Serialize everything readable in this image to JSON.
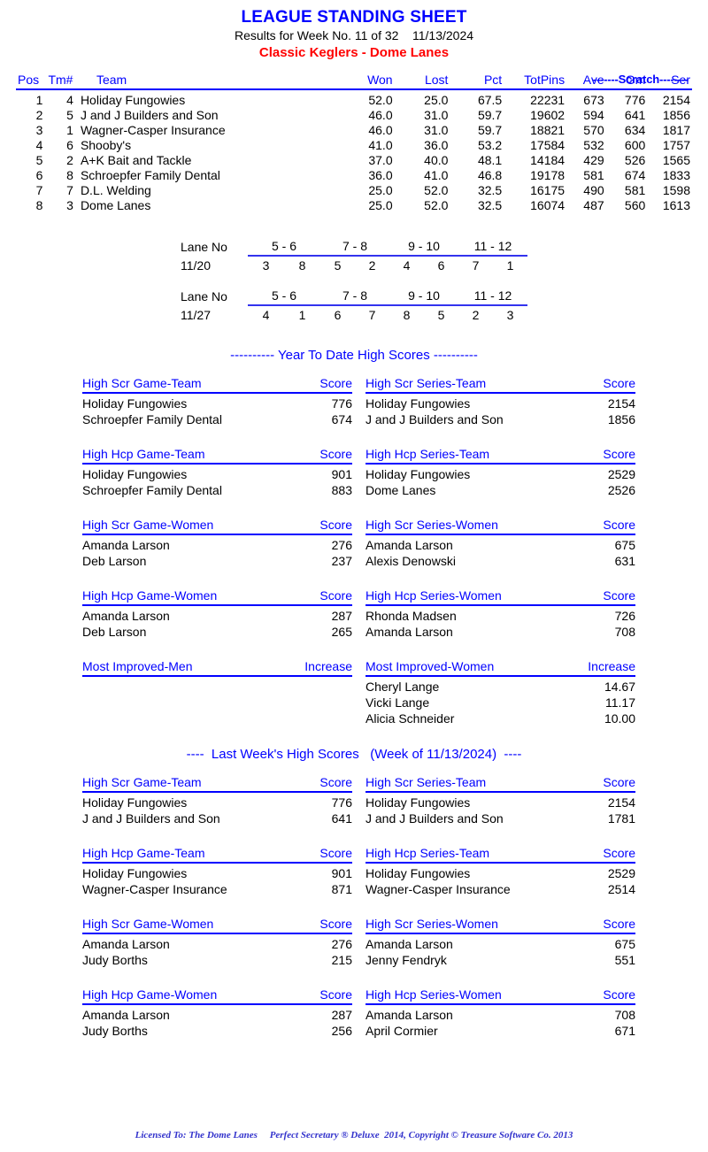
{
  "header": {
    "title": "LEAGUE STANDING SHEET",
    "subtitle": "Results for Week No. 11 of 32    11/13/2024",
    "league": "Classic Keglers - Dome Lanes"
  },
  "standings": {
    "scratch_label": "-------Scratch--------",
    "columns": {
      "pos": "Pos",
      "tm": "Tm#",
      "team": "Team",
      "won": "Won",
      "lost": "Lost",
      "pct": "Pct",
      "totpins": "TotPins",
      "ave": "Ave",
      "gm": "Gm",
      "ser": "Ser"
    },
    "rows": [
      {
        "pos": "1",
        "tm": "4",
        "team": "Holiday Fungowies",
        "won": "52.0",
        "lost": "25.0",
        "pct": "67.5",
        "totpins": "22231",
        "ave": "673",
        "gm": "776",
        "ser": "2154"
      },
      {
        "pos": "2",
        "tm": "5",
        "team": "J and J Builders and Son",
        "won": "46.0",
        "lost": "31.0",
        "pct": "59.7",
        "totpins": "19602",
        "ave": "594",
        "gm": "641",
        "ser": "1856"
      },
      {
        "pos": "3",
        "tm": "1",
        "team": "Wagner-Casper Insurance",
        "won": "46.0",
        "lost": "31.0",
        "pct": "59.7",
        "totpins": "18821",
        "ave": "570",
        "gm": "634",
        "ser": "1817"
      },
      {
        "pos": "4",
        "tm": "6",
        "team": "Shooby's",
        "won": "41.0",
        "lost": "36.0",
        "pct": "53.2",
        "totpins": "17584",
        "ave": "532",
        "gm": "600",
        "ser": "1757"
      },
      {
        "pos": "5",
        "tm": "2",
        "team": "A+K Bait and Tackle",
        "won": "37.0",
        "lost": "40.0",
        "pct": "48.1",
        "totpins": "14184",
        "ave": "429",
        "gm": "526",
        "ser": "1565"
      },
      {
        "pos": "6",
        "tm": "8",
        "team": "Schroepfer Family Dental",
        "won": "36.0",
        "lost": "41.0",
        "pct": "46.8",
        "totpins": "19178",
        "ave": "581",
        "gm": "674",
        "ser": "1833"
      },
      {
        "pos": "7",
        "tm": "7",
        "team": "D.L. Welding",
        "won": "25.0",
        "lost": "52.0",
        "pct": "32.5",
        "totpins": "16175",
        "ave": "490",
        "gm": "581",
        "ser": "1598"
      },
      {
        "pos": "8",
        "tm": "3",
        "team": "Dome Lanes",
        "won": "25.0",
        "lost": "52.0",
        "pct": "32.5",
        "totpins": "16074",
        "ave": "487",
        "gm": "560",
        "ser": "1613"
      }
    ]
  },
  "lane_schedule": [
    {
      "label": "Lane No",
      "date": "11/20",
      "lanes": [
        "5 - 6",
        "7 - 8",
        "9 - 10",
        "11 - 12"
      ],
      "matchups": [
        [
          "3",
          "8"
        ],
        [
          "5",
          "2"
        ],
        [
          "4",
          "6"
        ],
        [
          "7",
          "1"
        ]
      ]
    },
    {
      "label": "Lane No",
      "date": "11/27",
      "lanes": [
        "5 - 6",
        "7 - 8",
        "9 - 10",
        "11 - 12"
      ],
      "matchups": [
        [
          "4",
          "1"
        ],
        [
          "6",
          "7"
        ],
        [
          "8",
          "5"
        ],
        [
          "2",
          "3"
        ]
      ]
    }
  ],
  "ytd": {
    "heading": "---------- Year To Date High Scores ----------",
    "blocks": [
      {
        "left": {
          "title": "High Scr Game-Team",
          "score_label": "Score",
          "rows": [
            {
              "name": "Holiday Fungowies",
              "value": "776"
            },
            {
              "name": "Schroepfer Family Dental",
              "value": "674"
            }
          ]
        },
        "right": {
          "title": "High Scr Series-Team",
          "score_label": "Score",
          "rows": [
            {
              "name": "Holiday Fungowies",
              "value": "2154"
            },
            {
              "name": "J and J Builders and Son",
              "value": "1856"
            }
          ]
        }
      },
      {
        "left": {
          "title": "High Hcp Game-Team",
          "score_label": "Score",
          "rows": [
            {
              "name": "Holiday Fungowies",
              "value": "901"
            },
            {
              "name": "Schroepfer Family Dental",
              "value": "883"
            }
          ]
        },
        "right": {
          "title": "High Hcp Series-Team",
          "score_label": "Score",
          "rows": [
            {
              "name": "Holiday Fungowies",
              "value": "2529"
            },
            {
              "name": "Dome Lanes",
              "value": "2526"
            }
          ]
        }
      },
      {
        "left": {
          "title": "High Scr Game-Women",
          "score_label": "Score",
          "rows": [
            {
              "name": "Amanda Larson",
              "value": "276"
            },
            {
              "name": "Deb Larson",
              "value": "237"
            }
          ]
        },
        "right": {
          "title": "High Scr Series-Women",
          "score_label": "Score",
          "rows": [
            {
              "name": "Amanda Larson",
              "value": "675"
            },
            {
              "name": "Alexis Denowski",
              "value": "631"
            }
          ]
        }
      },
      {
        "left": {
          "title": "High Hcp Game-Women",
          "score_label": "Score",
          "rows": [
            {
              "name": "Amanda Larson",
              "value": "287"
            },
            {
              "name": "Deb Larson",
              "value": "265"
            }
          ]
        },
        "right": {
          "title": "High Hcp Series-Women",
          "score_label": "Score",
          "rows": [
            {
              "name": "Rhonda Madsen",
              "value": "726"
            },
            {
              "name": "Amanda Larson",
              "value": "708"
            }
          ]
        }
      },
      {
        "left": {
          "title": "Most Improved-Men",
          "score_label": "Increase",
          "rows": []
        },
        "right": {
          "title": "Most Improved-Women",
          "score_label": "Increase",
          "rows": [
            {
              "name": "Cheryl Lange",
              "value": "14.67"
            },
            {
              "name": "Vicki Lange",
              "value": "11.17"
            },
            {
              "name": "Alicia Schneider",
              "value": "10.00"
            }
          ]
        }
      }
    ]
  },
  "last_week": {
    "heading": "----  Last Week's High Scores   (Week of 11/13/2024)  ----",
    "blocks": [
      {
        "left": {
          "title": "High Scr Game-Team",
          "score_label": "Score",
          "rows": [
            {
              "name": "Holiday Fungowies",
              "value": "776"
            },
            {
              "name": "J and J Builders and Son",
              "value": "641"
            }
          ]
        },
        "right": {
          "title": "High Scr Series-Team",
          "score_label": "Score",
          "rows": [
            {
              "name": "Holiday Fungowies",
              "value": "2154"
            },
            {
              "name": "J and J Builders and Son",
              "value": "1781"
            }
          ]
        }
      },
      {
        "left": {
          "title": "High Hcp Game-Team",
          "score_label": "Score",
          "rows": [
            {
              "name": "Holiday Fungowies",
              "value": "901"
            },
            {
              "name": "Wagner-Casper Insurance",
              "value": "871"
            }
          ]
        },
        "right": {
          "title": "High Hcp Series-Team",
          "score_label": "Score",
          "rows": [
            {
              "name": "Holiday Fungowies",
              "value": "2529"
            },
            {
              "name": "Wagner-Casper Insurance",
              "value": "2514"
            }
          ]
        }
      },
      {
        "left": {
          "title": "High Scr Game-Women",
          "score_label": "Score",
          "rows": [
            {
              "name": "Amanda Larson",
              "value": "276"
            },
            {
              "name": "Judy Borths",
              "value": "215"
            }
          ]
        },
        "right": {
          "title": "High Scr Series-Women",
          "score_label": "Score",
          "rows": [
            {
              "name": "Amanda Larson",
              "value": "675"
            },
            {
              "name": "Jenny Fendryk",
              "value": "551"
            }
          ]
        }
      },
      {
        "left": {
          "title": "High Hcp Game-Women",
          "score_label": "Score",
          "rows": [
            {
              "name": "Amanda Larson",
              "value": "287"
            },
            {
              "name": "Judy Borths",
              "value": "256"
            }
          ]
        },
        "right": {
          "title": "High Hcp Series-Women",
          "score_label": "Score",
          "rows": [
            {
              "name": "Amanda Larson",
              "value": "708"
            },
            {
              "name": "April Cormier",
              "value": "671"
            }
          ]
        }
      }
    ]
  },
  "footer": {
    "text": "Licensed To: The Dome Lanes     Perfect Secretary ® Deluxe  2014, Copyright © Treasure Software Co. 2013"
  },
  "colors": {
    "blue": "#0000ff",
    "red": "#ff0000",
    "black": "#000000",
    "footer_blue": "#3333cc"
  }
}
